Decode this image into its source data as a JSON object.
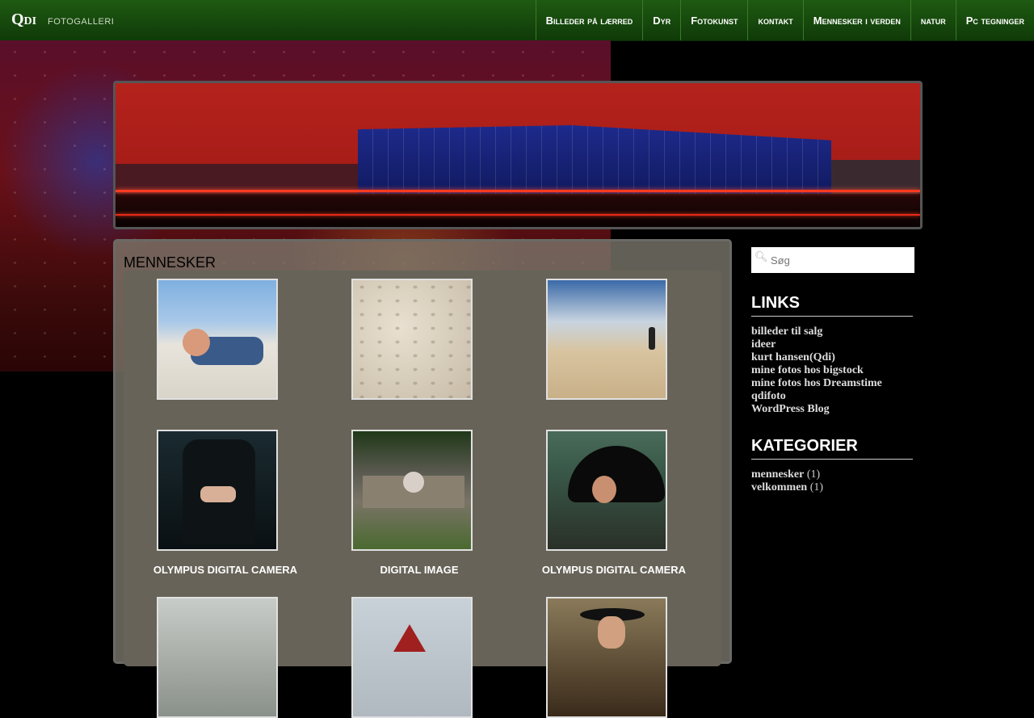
{
  "site": {
    "brand": "Qdi",
    "tagline": "FOTOGALLERI"
  },
  "nav": [
    {
      "label": "Billeder på lærred"
    },
    {
      "label": "Dyr"
    },
    {
      "label": "Fotokunst"
    },
    {
      "label": "kontakt"
    },
    {
      "label": "Mennesker i verden"
    },
    {
      "label": "natur"
    },
    {
      "label": "Pc tegninger"
    }
  ],
  "main": {
    "title": "MENNESKER",
    "captions": [
      "OLYMPUS DIGITAL CAMERA",
      "DIGITAL IMAGE",
      "OLYMPUS DIGITAL CAMERA"
    ]
  },
  "sidebar": {
    "search": {
      "placeholder": "Søg"
    },
    "links": {
      "title": "LINKS",
      "items": [
        {
          "label": "billeder til salg"
        },
        {
          "label": "ideer"
        },
        {
          "label": "kurt hansen(Qdi)"
        },
        {
          "label": "mine fotos hos bigstock"
        },
        {
          "label": "mine fotos hos Dreamstime"
        },
        {
          "label": "qdifoto"
        },
        {
          "label": "WordPress Blog"
        }
      ]
    },
    "categories": {
      "title": "KATEGORIER",
      "items": [
        {
          "label": "mennesker",
          "count": "(1)"
        },
        {
          "label": "velkommen",
          "count": "(1)"
        }
      ]
    }
  },
  "icons": {
    "search": "search-icon"
  }
}
